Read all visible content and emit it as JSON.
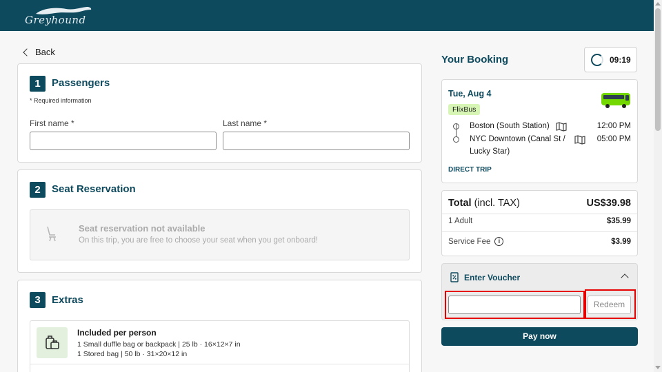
{
  "header": {
    "logo_text": "Greyhound"
  },
  "nav": {
    "back_label": "Back"
  },
  "passengers": {
    "step": "1",
    "title": "Passengers",
    "required_note": "* Required information",
    "first_name_label": "First name *",
    "last_name_label": "Last name *",
    "first_name_value": "",
    "last_name_value": ""
  },
  "seat": {
    "step": "2",
    "title": "Seat Reservation",
    "unavailable_title": "Seat reservation not available",
    "unavailable_text": "On this trip, you are free to choose your seat when you get onboard!"
  },
  "extras": {
    "step": "3",
    "title": "Extras",
    "included_title": "Included per person",
    "items": [
      "1 Small duffle bag or backpack | 25 lb · 16×12×7 in",
      "1 Stored bag | 50 lb · 31×20×12 in"
    ]
  },
  "booking": {
    "title": "Your Booking",
    "timer": "09:19",
    "date": "Tue, Aug 4",
    "carrier": "FlixBus",
    "from_stop": "Boston (South Station)",
    "to_stop_line1": "NYC Downtown (Canal St /",
    "to_stop_line2": "Lucky Star)",
    "depart_time": "12:00 PM",
    "arrive_time": "05:00 PM",
    "trip_type": "DIRECT TRIP",
    "colors": {
      "brand": "#0e4a5e",
      "carrier_badge": "#d7f5b5",
      "bus": "#73d700"
    }
  },
  "totals": {
    "total_label": "Total",
    "total_suffix": " (incl. TAX)",
    "total_amount": "US$39.98",
    "lines": [
      {
        "label": "1 Adult",
        "amount": "$35.99"
      },
      {
        "label": "Service Fee",
        "amount": "$3.99"
      }
    ]
  },
  "voucher": {
    "label": "Enter Voucher",
    "input_value": "",
    "redeem_label": "Redeem"
  },
  "pay": {
    "label": "Pay now"
  }
}
